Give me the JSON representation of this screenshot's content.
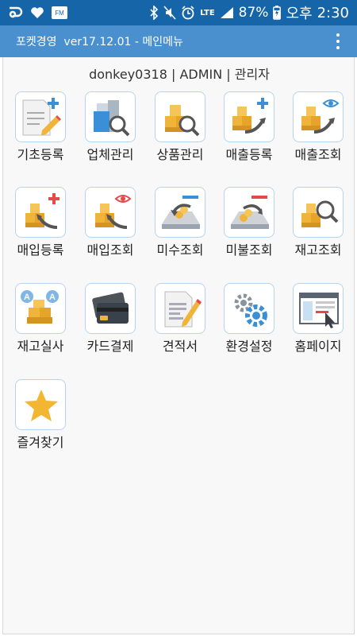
{
  "status_bar": {
    "battery": "87%",
    "network": "LTE",
    "ampm": "오후",
    "time": "2:30",
    "sim_label": "FM"
  },
  "app_bar": {
    "title": "포켓경영  ver17.12.01 - 메인메뉴"
  },
  "user_line": "donkey0318 | ADMIN | 관리자",
  "menu": [
    {
      "label": "기초등록",
      "icon": "document-plus-icon"
    },
    {
      "label": "업체관리",
      "icon": "company-search-icon"
    },
    {
      "label": "상품관리",
      "icon": "product-search-icon"
    },
    {
      "label": "매출등록",
      "icon": "sales-register-icon"
    },
    {
      "label": "매출조회",
      "icon": "sales-view-icon"
    },
    {
      "label": "매입등록",
      "icon": "purchase-register-icon"
    },
    {
      "label": "매입조회",
      "icon": "purchase-view-icon"
    },
    {
      "label": "미수조회",
      "icon": "receivable-view-icon"
    },
    {
      "label": "미불조회",
      "icon": "payable-view-icon"
    },
    {
      "label": "재고조회",
      "icon": "inventory-search-icon"
    },
    {
      "label": "재고실사",
      "icon": "inventory-audit-icon"
    },
    {
      "label": "카드결제",
      "icon": "credit-card-icon"
    },
    {
      "label": "견적서",
      "icon": "quote-document-icon"
    },
    {
      "label": "환경설정",
      "icon": "settings-gears-icon"
    },
    {
      "label": "홈페이지",
      "icon": "homepage-browser-icon"
    },
    {
      "label": "즐겨찾기",
      "icon": "star-icon"
    }
  ],
  "colors": {
    "status_bar": "#1565a8",
    "app_bar": "#4a90cf",
    "tile_border": "#b9d3ea",
    "box_orange": "#f0b43a",
    "accent_red": "#e44a4a",
    "accent_blue": "#3b8fd6",
    "star": "#f2b632"
  }
}
